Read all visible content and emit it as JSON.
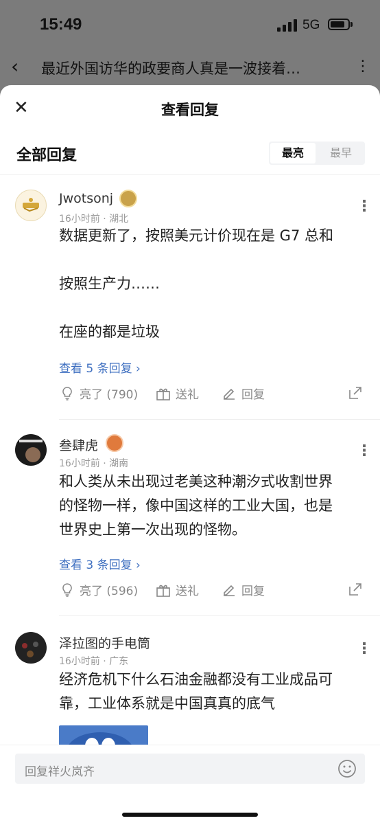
{
  "status": {
    "time": "15:49",
    "network": "5G"
  },
  "article": {
    "title": "最近外国访华的政要商人真是一波接着…"
  },
  "sheet": {
    "title": "查看回复",
    "all_label": "全部回复",
    "sort_options": [
      "最亮",
      "最早"
    ]
  },
  "comments": [
    {
      "username": "Jwotsonj",
      "meta": "16小时前 · 湖北",
      "text": [
        "数据更新了，按照美元计价现在是 G7 总和",
        "",
        "按照生产力……",
        "",
        "在座的都是垃圾"
      ],
      "view_replies": "查看 5 条回复 ›",
      "like": "亮了 (790)",
      "gift": "送礼",
      "reply": "回复"
    },
    {
      "username": "叁肆虎",
      "meta": "16小时前 · 湖南",
      "text": [
        "和人类从未出现过老美这种潮汐式收割世界",
        "的怪物一样，像中国这样的工业大国，也是",
        "世界史上第一次出现的怪物。"
      ],
      "view_replies": "查看 3 条回复 ›",
      "like": "亮了 (596)",
      "gift": "送礼",
      "reply": "回复"
    },
    {
      "username": "泽拉图的手电筒",
      "meta": "16小时前 · 广东",
      "text": [
        "经济危机下什么石油金融都没有工业成品可",
        "靠，工业体系就是中国真真的底气"
      ]
    }
  ],
  "bottom": {
    "placeholder": "回复祥火岚齐"
  },
  "colors": {
    "link": "#3e6fc0",
    "badge_gold": "#c9a24a",
    "badge_orange": "#e07a3c"
  },
  "icons": [
    "back-icon",
    "more-icon",
    "close-icon",
    "bulb-icon",
    "gift-icon",
    "reply-edit-icon",
    "share-icon",
    "emoji-icon"
  ]
}
